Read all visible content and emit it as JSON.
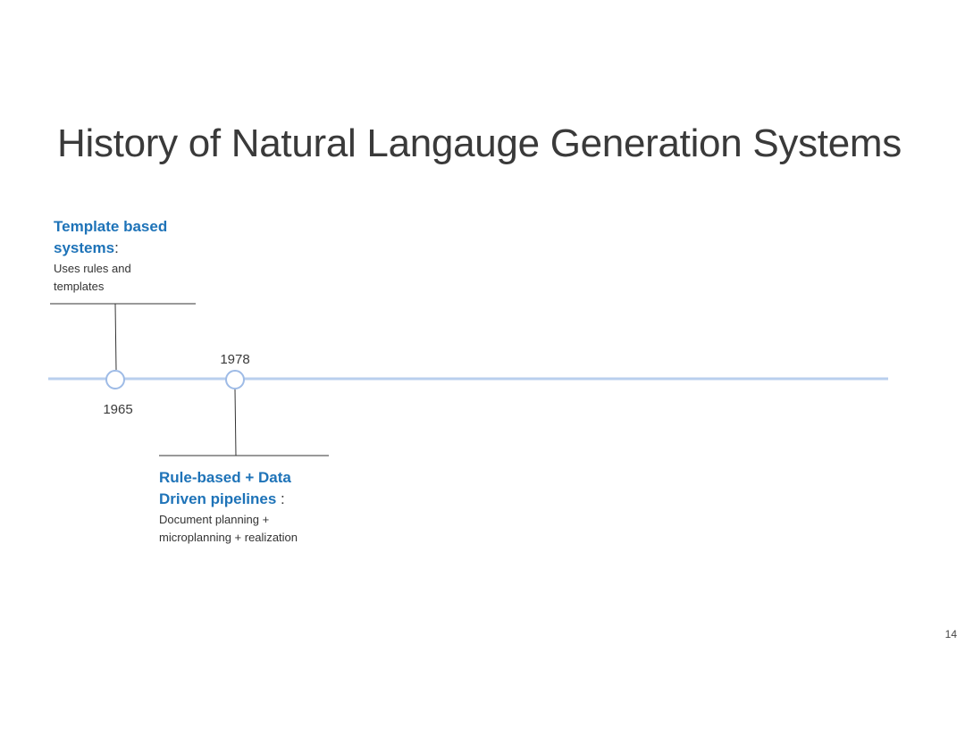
{
  "slide": {
    "title": "History of Natural Langauge Generation Systems",
    "page_number": "14"
  },
  "colors": {
    "timeline_line": "#b9cfee",
    "timeline_node_stroke": "#9ebbe6",
    "heading_blue": "#1e73b8",
    "connector": "#333333"
  },
  "timeline": {
    "milestones": [
      {
        "year": "1965",
        "heading": "Template based systems",
        "punct": ":",
        "description": "Uses rules and templates"
      },
      {
        "year": "1978",
        "heading": "Rule-based + Data Driven pipelines",
        "punct": " :",
        "description": "Document planning + microplanning + realization"
      }
    ]
  }
}
